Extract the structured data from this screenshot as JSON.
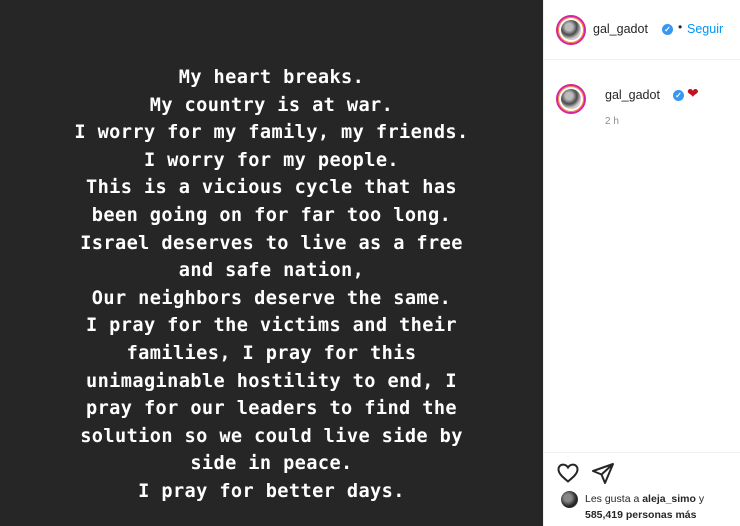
{
  "post": {
    "caption_lines": [
      "My heart breaks.",
      "My country is at war.",
      "I worry for my family, my friends.",
      "I worry for my people.",
      "This is a vicious cycle that has",
      "been going on for far too long.",
      "Israel deserves to live as a free",
      "and safe nation,",
      "Our neighbors deserve the same.",
      "I pray for the victims and their",
      "families, I pray for this",
      "unimaginable hostility to end, I",
      "pray for our leaders to find the",
      "solution so we could live side by",
      "side in peace.",
      "I pray for better days."
    ]
  },
  "header": {
    "username": "gal_gadot",
    "dot": "•",
    "follow_label": "Seguir"
  },
  "comment": {
    "username": "gal_gadot",
    "emoji": "❤",
    "time": "2 h"
  },
  "likes": {
    "prefix": "Les gusta a ",
    "user": "aleja_simo",
    "suffix": " y",
    "count": "585,419 personas más"
  },
  "colors": {
    "media_bg": "#262626",
    "link": "#0095f6",
    "verified": "#3897f0",
    "heart": "#c1121f"
  },
  "icons": {
    "verified": "verified-badge-icon",
    "like": "heart-outline-icon",
    "share": "paper-plane-icon"
  }
}
